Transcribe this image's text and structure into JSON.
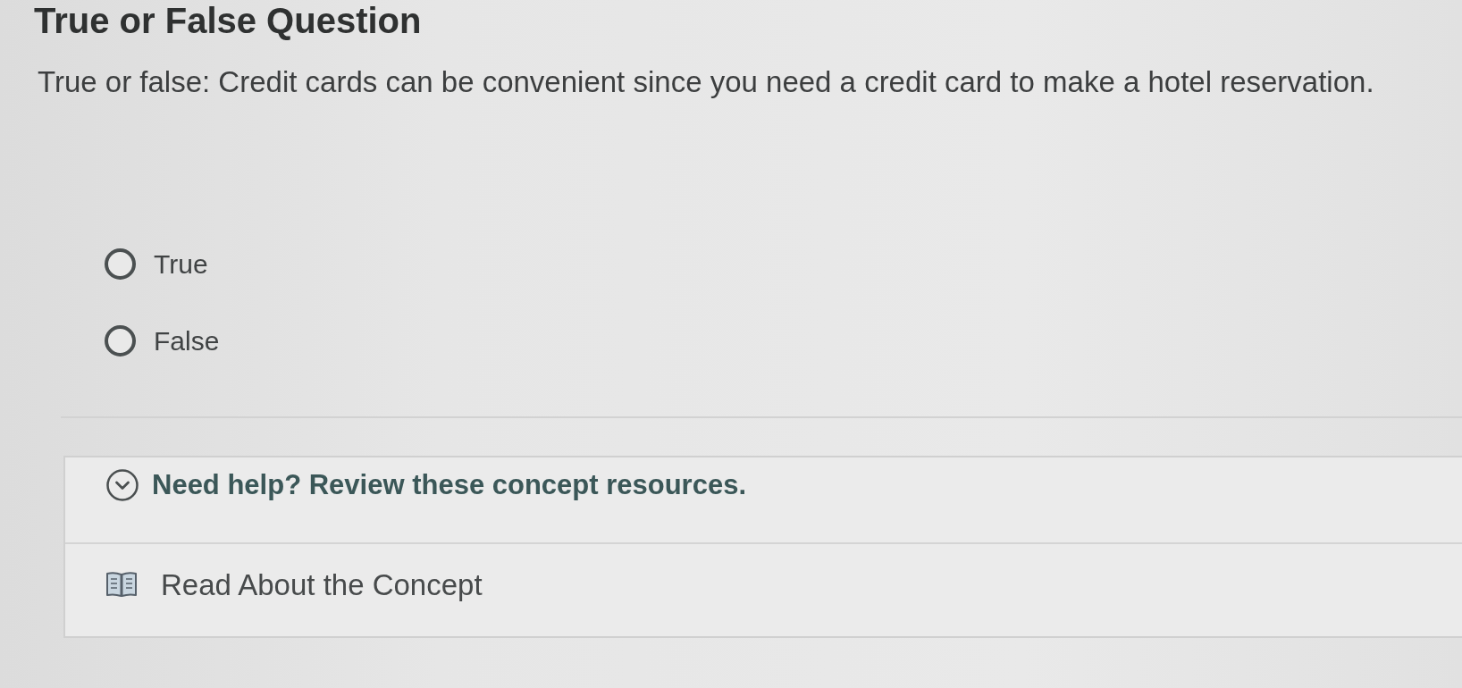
{
  "page": {
    "title": "True or False Question"
  },
  "question": {
    "prompt": "True or false: Credit cards can be convenient since you need a credit card to make a hotel reservation.",
    "options": [
      {
        "label": "True",
        "selected": false
      },
      {
        "label": "False",
        "selected": false
      }
    ]
  },
  "help_panel": {
    "heading": "Need help? Review these concept resources.",
    "expanded": true,
    "resources": [
      {
        "label": "Read About the Concept"
      }
    ]
  }
}
